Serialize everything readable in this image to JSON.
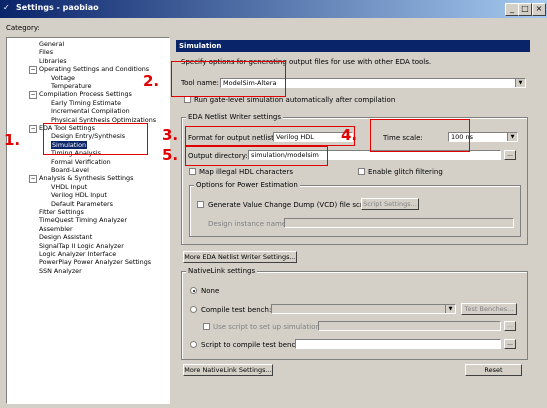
{
  "window": {
    "title": "Settings - paobiao",
    "title_icon": "settings-icon"
  },
  "category_label": "Category:",
  "tree": [
    {
      "label": "General"
    },
    {
      "label": "Files"
    },
    {
      "label": "Libraries"
    },
    {
      "label": "Operating Settings and Conditions",
      "expand": "−"
    },
    {
      "label": "Voltage"
    },
    {
      "label": "Temperature"
    },
    {
      "label": "Compilation Process Settings",
      "expand": "−"
    },
    {
      "label": "Early Timing Estimate"
    },
    {
      "label": "Incremental Compilation"
    },
    {
      "label": "Physical Synthesis Optimizations"
    },
    {
      "label": "EDA Tool Settings",
      "expand": "−"
    },
    {
      "label": "Design Entry/Synthesis"
    },
    {
      "label": "Simulation",
      "selected": true
    },
    {
      "label": "Timing Analysis"
    },
    {
      "label": "Formal Verification"
    },
    {
      "label": "Board-Level"
    },
    {
      "label": "Analysis & Synthesis Settings",
      "expand": "−"
    },
    {
      "label": "VHDL Input"
    },
    {
      "label": "Verilog HDL Input"
    },
    {
      "label": "Default Parameters"
    },
    {
      "label": "Fitter Settings"
    },
    {
      "label": "TimeQuest Timing Analyzer"
    },
    {
      "label": "Assembler"
    },
    {
      "label": "Design Assistant"
    },
    {
      "label": "SignalTap II Logic Analyzer"
    },
    {
      "label": "Logic Analyzer Interface"
    },
    {
      "label": "PowerPlay Power Analyzer Settings"
    },
    {
      "label": "SSN Analyzer"
    }
  ],
  "panel": {
    "header": "Simulation",
    "description": "Specify options for generating output files for use with other EDA tools.",
    "tool_name_label": "Tool name:",
    "tool_name_value": "ModelSim-Altera",
    "run_gate_level": "Run gate-level simulation automatically after compilation",
    "eda_netlist_group": "EDA Netlist Writer settings",
    "format_label": "Format for output netlist:",
    "format_value": "Verilog HDL",
    "time_scale_label": "Time scale:",
    "time_scale_value": "100 ns",
    "output_dir_label": "Output directory:",
    "output_dir_value": "simulation/modelsim",
    "browse_label": "...",
    "map_illegal": "Map illegal HDL characters",
    "enable_glitch": "Enable glitch filtering",
    "power_group": "Options for Power Estimation",
    "generate_vcd": "Generate Value Change Dump (VCD) file script",
    "script_settings": "Script Settings...",
    "design_instance_label": "Design instance name:",
    "more_eda_button": "More EDA Netlist Writer Settings...",
    "nativelink_group": "NativeLink settings",
    "radio_none": "None",
    "radio_compile_tb": "Compile test bench:",
    "test_benches_button": "Test Benches...",
    "use_script_setup": "Use script to set up simulation:",
    "radio_script_compile": "Script to compile test bench:",
    "more_nativelink_button": "More NativeLink Settings...",
    "reset_button": "Reset"
  },
  "annotations": [
    "1.",
    "2.",
    "3.",
    "4.",
    "5."
  ],
  "annotation_color": "#e00000",
  "title_buttons": [
    "_",
    "□",
    "×"
  ]
}
